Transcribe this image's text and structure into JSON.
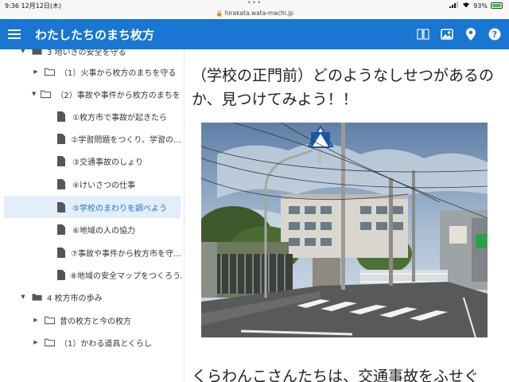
{
  "status_bar": {
    "time": "9:36",
    "date": "12月12日(木)",
    "url": "hirakata.wata-machi.jp",
    "battery": "93%"
  },
  "appbar": {
    "title": "わたしたちのまち枚方",
    "icons": [
      "book-icon",
      "photo-icon",
      "map-pin-icon",
      "help-icon"
    ],
    "color": "#1976d2"
  },
  "sidebar": {
    "items": [
      {
        "label": "3 地いきの安全を守る",
        "type": "folder-open",
        "expanded": true
      },
      {
        "label": "（1）火事から枚方のまちを守る",
        "type": "folder",
        "expanded": false
      },
      {
        "label": "（2）事故や事件から枚方のまちを…",
        "type": "folder-open",
        "expanded": true
      },
      {
        "label": "①枚方市で事故が起きたら",
        "type": "page"
      },
      {
        "label": "②学習問題をつくり、学習の…",
        "type": "page"
      },
      {
        "label": "③交通事故のしょり",
        "type": "page"
      },
      {
        "label": "④けいさつの仕事",
        "type": "page"
      },
      {
        "label": "⑤学校のまわりを調べよう",
        "type": "page",
        "selected": true
      },
      {
        "label": "⑥地域の人の協力",
        "type": "page"
      },
      {
        "label": "⑦事故や事件から枚方市を守…",
        "type": "page"
      },
      {
        "label": "⑧地域の安全マップをつくろう。",
        "type": "page"
      },
      {
        "label": "4 枚方市の歩み",
        "type": "folder-open",
        "expanded": true
      },
      {
        "label": "昔の枚方と今の枚方",
        "type": "folder",
        "expanded": false
      },
      {
        "label": "（1）かわる道具とくらし",
        "type": "folder",
        "expanded": false
      }
    ]
  },
  "main": {
    "heading": "（学校の正門前）どのようなしせつがあるのか、見つけてみよう！！",
    "subheading": "くらわんこさんたちは、交通事故をふせぐ",
    "photo": "school-gate-crosswalk-photo"
  }
}
